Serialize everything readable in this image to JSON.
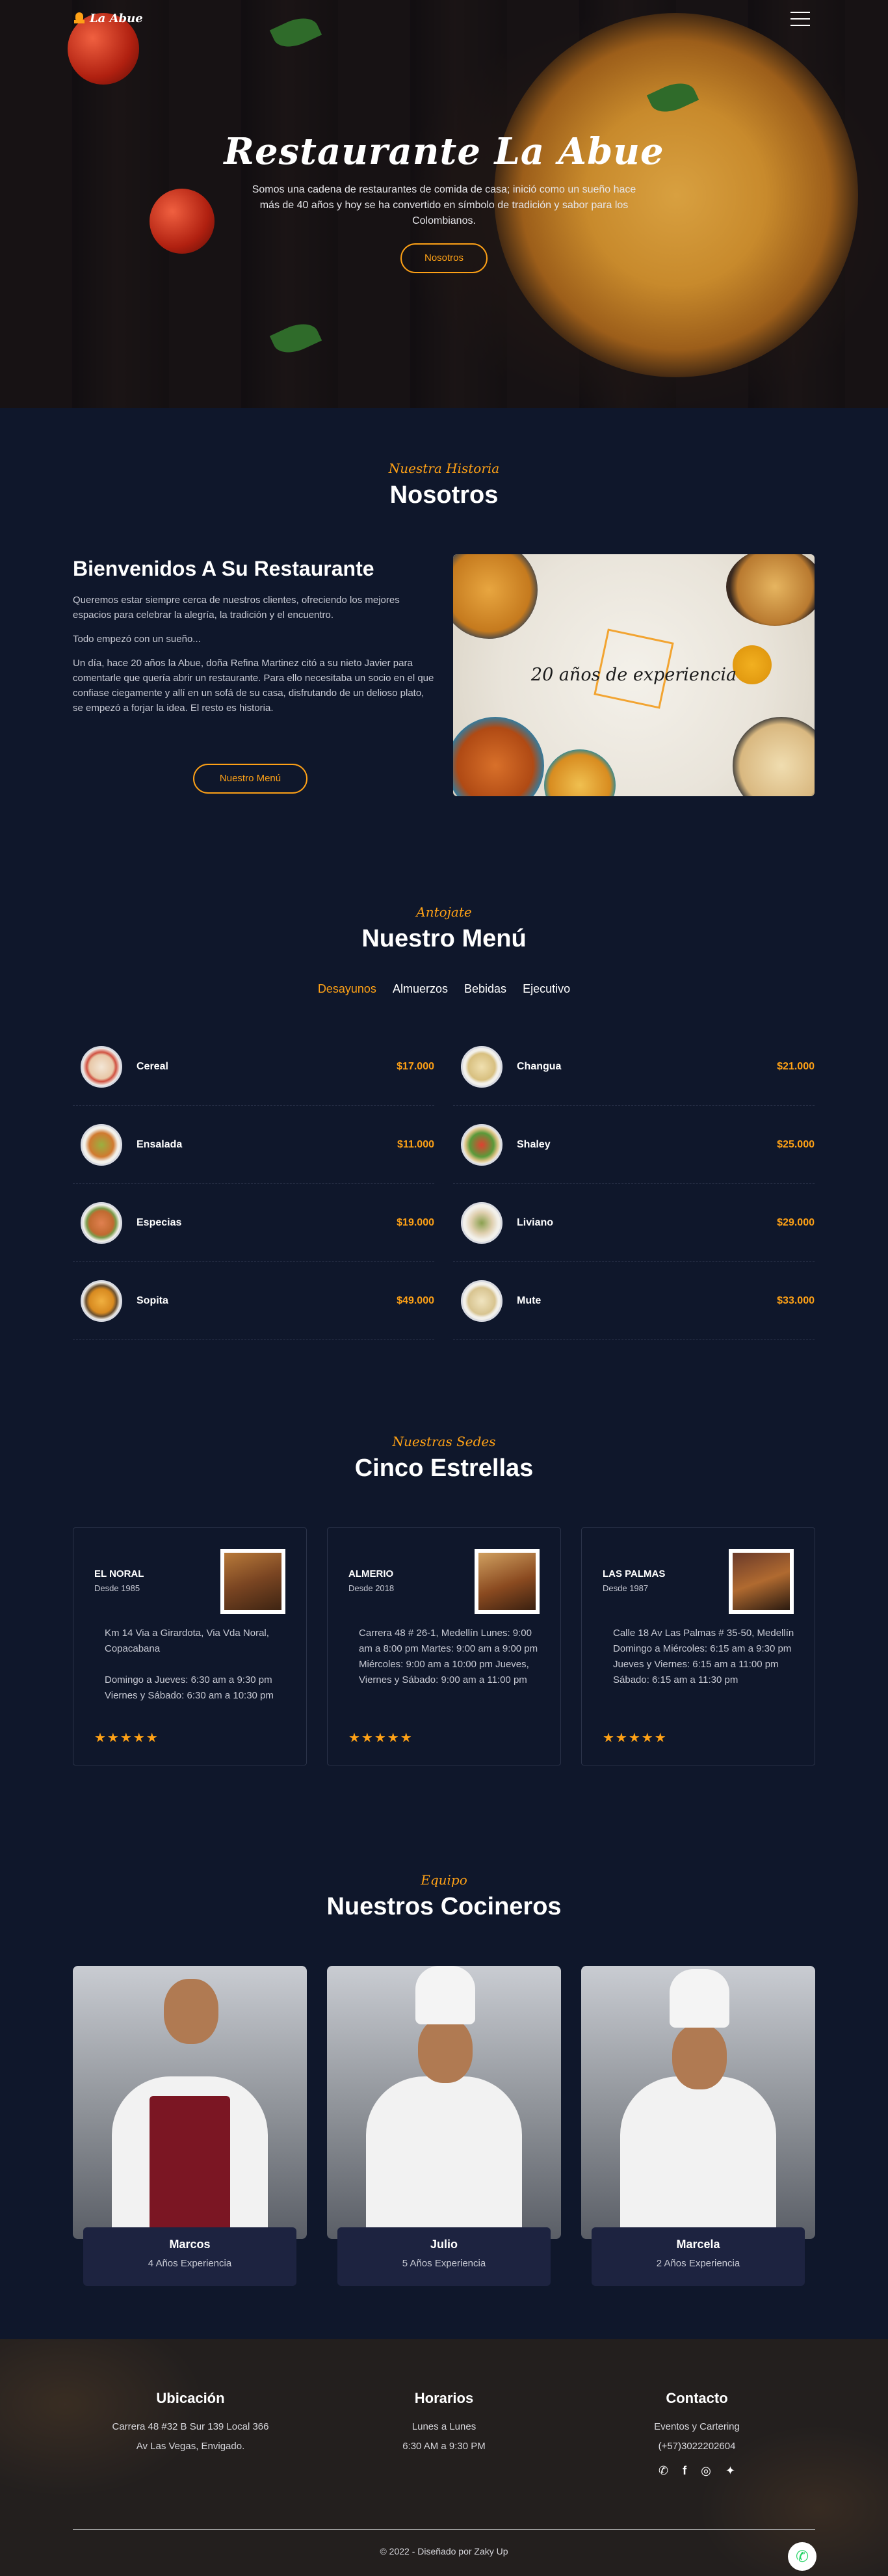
{
  "brand": {
    "name": "La Abue"
  },
  "hero": {
    "title": "Restaurante La Abue",
    "description": "Somos una cadena de restaurantes de comida de casa; inició como un sueño hace más de 40 años y hoy se ha convertido en símbolo de tradición y sabor para los Colombianos.",
    "button": "Nosotros"
  },
  "about": {
    "kicker": "Nuestra Historia",
    "title": "Nosotros",
    "heading": "Bienvenidos A Su Restaurante",
    "p1": "Queremos estar siempre cerca de nuestros clientes, ofreciendo los mejores espacios para celebrar la alegría, la tradición y el encuentro.",
    "p2": "Todo empezó con un sueño...",
    "p3": "Un día, hace 20 años la Abue, doña Refina Martinez citó a su nieto Javier para comentarle que quería abrir un restaurante. Para ello necesitaba un socio en el que confiase ciegamente y allí en un sofá de su casa, disfrutando de un delioso plato, se empezó a forjar la idea. El resto es historia.",
    "button": "Nuestro Menú",
    "image_caption": "20 años de experiencia"
  },
  "menu": {
    "kicker": "Antojate",
    "title": "Nuestro Menú",
    "tabs": [
      "Desayunos",
      "Almuerzos",
      "Bebidas",
      "Ejecutivo"
    ],
    "active_tab": "Desayunos",
    "items": [
      {
        "name": "Cereal",
        "price": "$17.000"
      },
      {
        "name": "Changua",
        "price": "$21.000"
      },
      {
        "name": "Ensalada",
        "price": "$11.000"
      },
      {
        "name": "Shaley",
        "price": "$25.000"
      },
      {
        "name": "Especias",
        "price": "$19.000"
      },
      {
        "name": "Liviano",
        "price": "$29.000"
      },
      {
        "name": "Sopita",
        "price": "$49.000"
      },
      {
        "name": "Mute",
        "price": "$33.000"
      }
    ]
  },
  "branches": {
    "kicker": "Nuestras Sedes",
    "title": "Cinco Estrellas",
    "items": [
      {
        "name": "EL NORAL",
        "since": "Desde 1985",
        "text": "Km 14 Via a Girardota, Via Vda Noral, Copacabana\n\nDomingo a Jueves: 6:30 am a 9:30 pm Viernes y Sábado: 6:30 am a 10:30 pm",
        "stars": "★★★★★"
      },
      {
        "name": "ALMERIO",
        "since": "Desde 2018",
        "text": "Carrera 48 # 26-1, Medellín Lunes: 9:00 am a 8:00 pm Martes: 9:00 am a 9:00 pm Miércoles: 9:00 am a 10:00 pm Jueves, Viernes y Sábado: 9:00 am a 11:00 pm",
        "stars": "★★★★★"
      },
      {
        "name": "LAS PALMAS",
        "since": "Desde 1987",
        "text": "Calle 18 Av Las Palmas # 35-50, Medellín Domingo a Miércoles: 6:15 am a 9:30 pm Jueves y Viernes: 6:15 am a 11:00 pm Sábado: 6:15 am a 11:30 pm",
        "stars": "★★★★★"
      }
    ]
  },
  "chefs": {
    "kicker": "Equipo",
    "title": "Nuestros Cocineros",
    "items": [
      {
        "name": "Marcos",
        "experience": "4 Años Experiencia"
      },
      {
        "name": "Julio",
        "experience": "5 Años Experiencia"
      },
      {
        "name": "Marcela",
        "experience": "2 Años Experiencia"
      }
    ]
  },
  "footer": {
    "location": {
      "title": "Ubicación",
      "line1": "Carrera 48 #32 B Sur 139 Local 366",
      "line2": "Av Las Vegas, Envigado."
    },
    "hours": {
      "title": "Horarios",
      "line1": "Lunes a Lunes",
      "line2": "6:30 AM a 9:30 PM"
    },
    "contact": {
      "title": "Contacto",
      "line1": "Eventos y Cartering",
      "line2": "(+57)3022202604"
    },
    "socials": [
      "whatsapp-icon",
      "facebook-icon",
      "instagram-icon",
      "twitter-icon"
    ],
    "copyright": "© 2022 - Diseñado por Zaky Up"
  },
  "colors": {
    "accent": "#fea116",
    "background": "#0f172b",
    "card": "#1d2340"
  }
}
